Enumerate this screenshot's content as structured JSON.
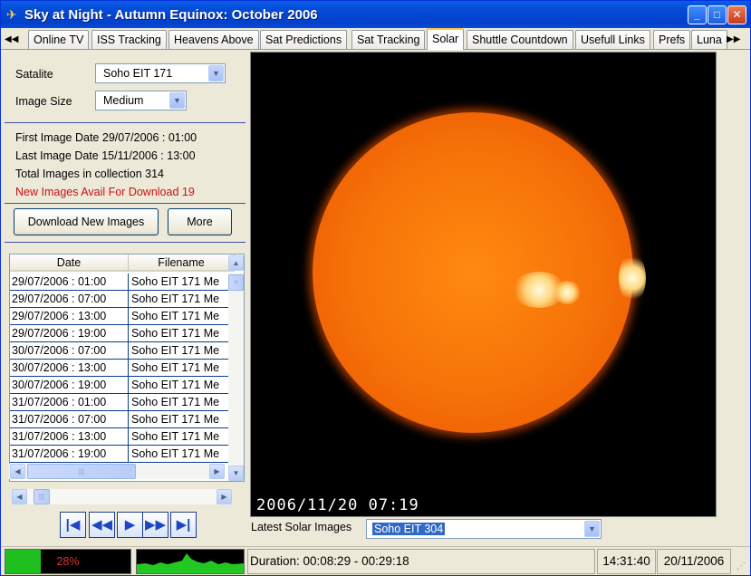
{
  "window": {
    "title": "Sky at Night - Autumn Equinox: October 2006",
    "minimize_icon": "minimize-icon",
    "maximize_icon": "maximize-icon",
    "close_icon": "close-icon"
  },
  "tabs": {
    "scroll_left": "◀◀",
    "scroll_right": "▶▶",
    "items": [
      {
        "label": "Online TV"
      },
      {
        "label": "ISS Tracking"
      },
      {
        "label": "Heavens Above"
      },
      {
        "label": "Sat Predictions"
      },
      {
        "label": "Sat Tracking"
      },
      {
        "label": "Solar"
      },
      {
        "label": "Shuttle Countdown"
      },
      {
        "label": "Usefull Links"
      },
      {
        "label": "Prefs"
      },
      {
        "label": "Luna"
      }
    ],
    "active": "Solar"
  },
  "settings": {
    "satellite_label": "Satalite",
    "satellite_value": "Soho EIT 171",
    "image_size_label": "Image Size",
    "image_size_value": "Medium"
  },
  "info": {
    "first_image": "First Image Date 29/07/2006 : 01:00",
    "last_image": "Last Image Date 15/11/2006 : 13:00",
    "total_images": "Total Images in collection 314",
    "new_images": "New Images Avail For Download 19"
  },
  "buttons": {
    "download": "Download New Images",
    "more": "More"
  },
  "grid": {
    "columns": [
      "Date",
      "Filename"
    ],
    "rows": [
      [
        "29/07/2006 : 01:00",
        "Soho EIT 171 Me"
      ],
      [
        "29/07/2006 : 07:00",
        "Soho EIT 171 Me"
      ],
      [
        "29/07/2006 : 13:00",
        "Soho EIT 171 Me"
      ],
      [
        "29/07/2006 : 19:00",
        "Soho EIT 171 Me"
      ],
      [
        "30/07/2006 : 07:00",
        "Soho EIT 171 Me"
      ],
      [
        "30/07/2006 : 13:00",
        "Soho EIT 171 Me"
      ],
      [
        "30/07/2006 : 19:00",
        "Soho EIT 171 Me"
      ],
      [
        "31/07/2006 : 01:00",
        "Soho EIT 171 Me"
      ],
      [
        "31/07/2006 : 07:00",
        "Soho EIT 171 Me"
      ],
      [
        "31/07/2006 : 13:00",
        "Soho EIT 171 Me"
      ],
      [
        "31/07/2006 : 19:00",
        "Soho EIT 171 Me"
      ]
    ]
  },
  "navigation": {
    "first_icon": "skip-first-icon",
    "prev_icon": "rewind-icon",
    "play_icon": "play-icon",
    "next_icon": "fast-forward-icon",
    "last_icon": "skip-last-icon"
  },
  "solar_image": {
    "timestamp": "2006/11/20 07:19"
  },
  "latest": {
    "label": "Latest Solar Images",
    "value": "Soho EIT 304"
  },
  "status": {
    "progress_text": "28%",
    "progress_value": 0.28,
    "duration": "Duration: 00:08:29 - 00:29:18",
    "time": "14:31:40",
    "date": "20/11/2006"
  },
  "colors": {
    "title_bar": "#0348d6",
    "highlight_text": "#cc1010",
    "progress_fill": "#1fbf1f",
    "selection": "#316ac5"
  }
}
